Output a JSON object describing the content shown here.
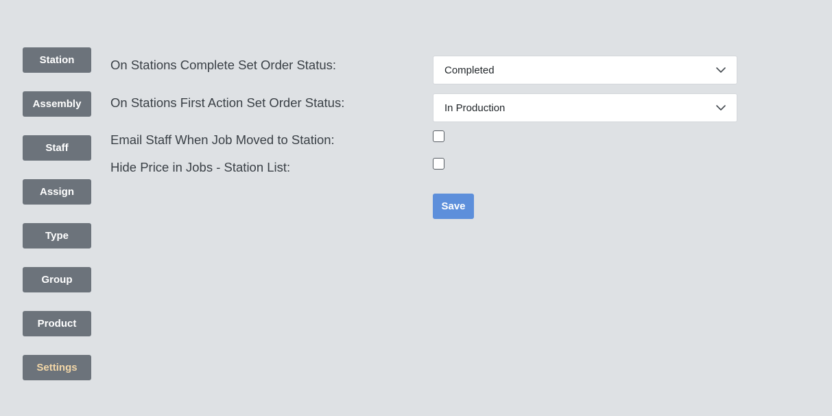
{
  "sidebar": {
    "items": [
      {
        "label": "Station"
      },
      {
        "label": "Assembly"
      },
      {
        "label": "Staff"
      },
      {
        "label": "Assign"
      },
      {
        "label": "Type"
      },
      {
        "label": "Group"
      },
      {
        "label": "Product"
      },
      {
        "label": "Settings",
        "active": true
      }
    ],
    "button_color": "#6c737b",
    "active_text_color": "#f2d6a7"
  },
  "form": {
    "complete_status": {
      "label": "On Stations Complete Set Order Status:",
      "value": "Completed",
      "icon": "chevron-down-icon"
    },
    "first_action_status": {
      "label": "On Stations First Action Set Order Status:",
      "value": "In Production",
      "icon": "chevron-down-icon"
    },
    "email_staff": {
      "label": "Email Staff When Job Moved to Station:",
      "checked": false
    },
    "hide_price": {
      "label": "Hide Price in Jobs - Station List:",
      "checked": false
    },
    "save_label": "Save",
    "save_color": "#5d8fdb"
  }
}
